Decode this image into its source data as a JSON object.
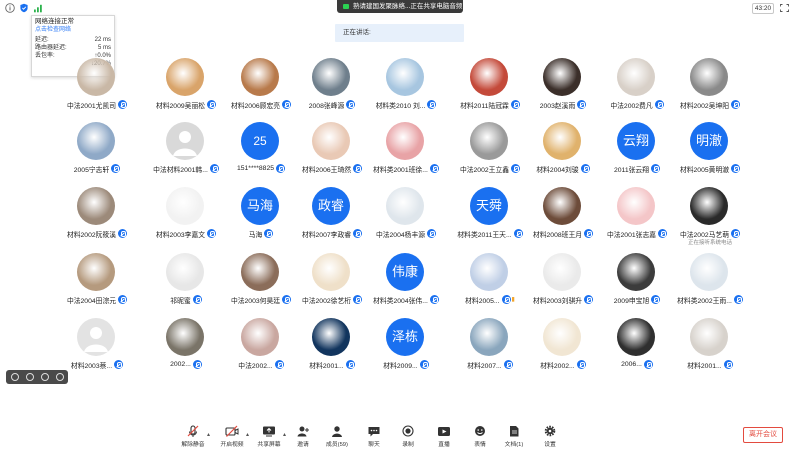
{
  "topbar": {
    "share_banner": "熟请建国发聚脉络...正在共享电脑音频",
    "timer": "43:20"
  },
  "network": {
    "title": "网络连接正常",
    "link": "点击检查网络",
    "rows": [
      {
        "label": "延迟:",
        "value": "22 ms"
      },
      {
        "label": "路由器延迟:",
        "value": "5 ms"
      },
      {
        "label": "丢包率:",
        "value": "↑0.0%"
      },
      {
        "label": "",
        "value": "↓20.7%"
      }
    ]
  },
  "speaking": "正在讲话:",
  "participants": [
    {
      "name": "中法2001尤凯司",
      "avatar": "photo",
      "color": "#c9b8a6"
    },
    {
      "name": "材料2009吴丽松",
      "avatar": "photo",
      "color": "#d9a46a"
    },
    {
      "name": "材料2006顾宏亮",
      "avatar": "photo",
      "color": "#b87a4b"
    },
    {
      "name": "2008张峰源",
      "avatar": "photo",
      "color": "#6f7f8c"
    },
    {
      "name": "材料类2010 刘...",
      "avatar": "photo",
      "color": "#a7c6e0"
    },
    {
      "name": "材料2011陆冠霖",
      "avatar": "photo",
      "color": "#c44a3a"
    },
    {
      "name": "2003赵溪雨",
      "avatar": "photo",
      "color": "#3b2f2a"
    },
    {
      "name": "中法2002费凡",
      "avatar": "photo",
      "color": "#d8d0c8"
    },
    {
      "name": "材料2002吴坤阳",
      "avatar": "photo",
      "color": "#8a8a8a"
    },
    {
      "name": "2005宁志轩",
      "avatar": "photo",
      "color": "#8fa9c7"
    },
    {
      "name": "中法材料2001韩...",
      "avatar": "gray",
      "color": "#d9d9d9"
    },
    {
      "name": "151****8825",
      "avatar": "text",
      "text": "25",
      "color": "#1a70f0"
    },
    {
      "name": "材料2006王琦然",
      "avatar": "photo",
      "color": "#e9c9b5"
    },
    {
      "name": "材料类2001班徐...",
      "avatar": "photo",
      "color": "#e8a3a6"
    },
    {
      "name": "中法2002王立鑫",
      "avatar": "photo",
      "color": "#9a9a9a"
    },
    {
      "name": "材料2004刘骏",
      "avatar": "photo",
      "color": "#e0b26c"
    },
    {
      "name": "2011张云翔",
      "avatar": "text",
      "text": "云翔",
      "color": "#1a70f0"
    },
    {
      "name": "材料2005黄明澈",
      "avatar": "text",
      "text": "明澈",
      "color": "#1a70f0"
    },
    {
      "name": "材料2002阮筱溪",
      "avatar": "photo",
      "color": "#9c8a7a"
    },
    {
      "name": "材料2003李嘉文",
      "avatar": "photo",
      "color": "#f2f2f2"
    },
    {
      "name": "马海",
      "avatar": "text",
      "text": "马海",
      "color": "#1a70f0"
    },
    {
      "name": "材料2007李政睿",
      "avatar": "text",
      "text": "政睿",
      "color": "#1a70f0"
    },
    {
      "name": "中法2004杨丰源",
      "avatar": "photo",
      "color": "#dfe6ec"
    },
    {
      "name": "材料类2011王天...",
      "avatar": "text",
      "text": "天舜",
      "color": "#1a70f0"
    },
    {
      "name": "材料2008班王月",
      "avatar": "photo",
      "color": "#6d4c3a"
    },
    {
      "name": "中法2001张志嘉",
      "avatar": "photo",
      "color": "#f4c6c8"
    },
    {
      "name": "中法2002马艺萌",
      "avatar": "photo",
      "color": "#2a2a2a",
      "status": "正在接听系统电话"
    },
    {
      "name": "中法2004田淙元",
      "avatar": "photo",
      "color": "#b59a7e"
    },
    {
      "name": "祁昵蜜",
      "avatar": "photo",
      "color": "#e7e7e7"
    },
    {
      "name": "中法2003何昊廷",
      "avatar": "photo",
      "color": "#8b6d5a"
    },
    {
      "name": "中法2002徐艺桁",
      "avatar": "photo",
      "color": "#efe0c9"
    },
    {
      "name": "材料类2004张伟...",
      "avatar": "text",
      "text": "伟康",
      "color": "#1a70f0"
    },
    {
      "name": "材料2005...",
      "avatar": "photo",
      "color": "#c0cfe6",
      "volume": true
    },
    {
      "name": "材料2003刘骐升",
      "avatar": "photo",
      "color": "#eaeaea"
    },
    {
      "name": "2009申宝旭",
      "avatar": "photo",
      "color": "#3c3c3c"
    },
    {
      "name": "材料类2002王雨...",
      "avatar": "photo",
      "color": "#dde5ec"
    },
    {
      "name": "材料2003蔡...",
      "avatar": "gray",
      "color": "#e3e3e3"
    },
    {
      "name": "2002...",
      "avatar": "photo",
      "color": "#7a7468"
    },
    {
      "name": "中法2002...",
      "avatar": "photo",
      "color": "#c9a7a0"
    },
    {
      "name": "材料2001...",
      "avatar": "photo",
      "color": "#12355e"
    },
    {
      "name": "材料2009...",
      "avatar": "text",
      "text": "泽栋",
      "color": "#1a70f0"
    },
    {
      "name": "材料2007...",
      "avatar": "photo",
      "color": "#8aa6bd"
    },
    {
      "name": "材料2002...",
      "avatar": "photo",
      "color": "#f1e6d3"
    },
    {
      "name": "2006...",
      "avatar": "photo",
      "color": "#2f2f2f"
    },
    {
      "name": "材料2001...",
      "avatar": "photo",
      "color": "#d7d2cc"
    }
  ],
  "toolbar": {
    "items": [
      {
        "id": "unmute",
        "label": "解除静音",
        "icon": "mic-off-icon"
      },
      {
        "id": "video",
        "label": "开启视频",
        "icon": "camera-off-icon"
      },
      {
        "id": "share",
        "label": "共享屏幕",
        "icon": "share-screen-icon"
      },
      {
        "id": "invite",
        "label": "邀请",
        "icon": "invite-icon"
      },
      {
        "id": "members",
        "label": "成员(59)",
        "icon": "members-icon"
      },
      {
        "id": "chat",
        "label": "聊天",
        "icon": "chat-icon"
      },
      {
        "id": "record",
        "label": "录制",
        "icon": "record-icon"
      },
      {
        "id": "live",
        "label": "直播",
        "icon": "live-icon"
      },
      {
        "id": "emoji",
        "label": "表情",
        "icon": "emoji-icon"
      },
      {
        "id": "docs",
        "label": "文档(1)",
        "icon": "document-icon"
      },
      {
        "id": "settings",
        "label": "设置",
        "icon": "gear-icon"
      }
    ],
    "leave": "离开会议"
  }
}
